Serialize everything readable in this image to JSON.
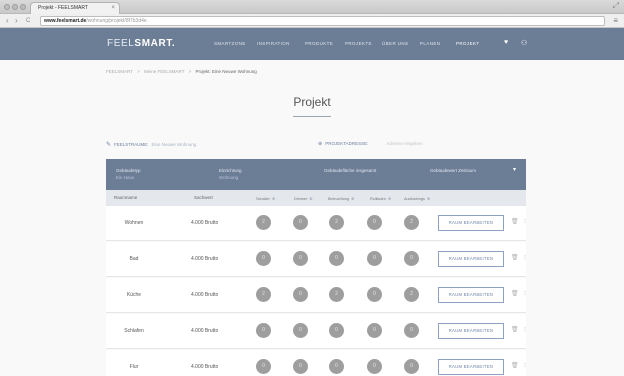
{
  "browser": {
    "tab_title": "Projekt - FEELSMART",
    "tab_close": "×",
    "url_host": "www.feelsmart.de",
    "url_path": "/wohnung/projekt/8f7b3d4e",
    "back": "‹",
    "forward": "›",
    "reload": "C",
    "menu": "≡",
    "resize": "⤢"
  },
  "header": {
    "logo_light": "FEEL",
    "logo_bold": "SMART.",
    "nav": [
      "SMARTZONE",
      "INSPIRATION",
      "PRODUKTE",
      "PROJEKTE",
      "ÜBER UNS",
      "PLANEN",
      "PROJEKT"
    ],
    "active_nav_index": 6,
    "heart_icon": "♥",
    "user_icon": "⚇"
  },
  "breadcrumb": {
    "items": [
      "FEELSMART",
      "Meine FEELSMART"
    ],
    "current": "Projekt: Eine Neuwe Wohnung",
    "separator": ">"
  },
  "page": {
    "title": "Projekt"
  },
  "meta": {
    "bullet_left": "✎",
    "left_label": "FEELSTRAUME:",
    "left_value": "Eine Neuwe Wohnung",
    "bullet_right": "⊕",
    "right_label": "PROJEKTADRESSE:",
    "right_value": "Adresse eingeben"
  },
  "summary": {
    "blocks": [
      {
        "label": "Gebäudetyp",
        "value": "Ein Haus"
      },
      {
        "label": "Einrichtung",
        "value": "Wohnung"
      },
      {
        "label": "Gebäudefläche insgesamt",
        "value": ""
      },
      {
        "label": "Gebäudewert Zeitraum",
        "value": ""
      }
    ],
    "chevron": "▾"
  },
  "table": {
    "headers": {
      "room": "Raumname",
      "area": "Sachwert",
      "categories": [
        "Schalter",
        "Dimmer",
        "Beleuchtung",
        "Rollladen",
        "Audiostrings"
      ]
    },
    "plus": "⊕",
    "edit_label": "RAUM BEARBEITEN",
    "trash_icon": "🗑",
    "more_icon": "⁝",
    "rows": [
      {
        "name": "Wohnen",
        "area": "4.000 Brutto",
        "values": [
          "2",
          "0",
          "2",
          "0",
          "2"
        ]
      },
      {
        "name": "Bad",
        "area": "4.000 Brutto",
        "values": [
          "0",
          "0",
          "0",
          "0",
          "0"
        ]
      },
      {
        "name": "Küche",
        "area": "4.000 Brutto",
        "values": [
          "2",
          "0",
          "2",
          "0",
          "2"
        ]
      },
      {
        "name": "Schlafen",
        "area": "4.000 Brutto",
        "values": [
          "0",
          "0",
          "0",
          "0",
          "0"
        ]
      },
      {
        "name": "Flur",
        "area": "4.000 Brutto",
        "values": [
          "0",
          "0",
          "0",
          "0",
          "0"
        ]
      }
    ]
  },
  "colors": {
    "header_blue": "#6c7d96",
    "circle_grey": "#9e9e9e",
    "button_border": "#8da1c0"
  }
}
